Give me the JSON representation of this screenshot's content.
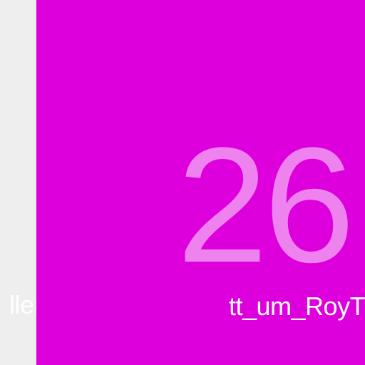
{
  "theme": {
    "background": "#eeeeee",
    "tile_color": "#dd00dd",
    "number_color": "#ee82ee",
    "label_color": "#ffffff"
  },
  "left_item": {
    "label": "ller"
  },
  "main_tile": {
    "number": "26",
    "label": "tt_um_RoyT"
  }
}
